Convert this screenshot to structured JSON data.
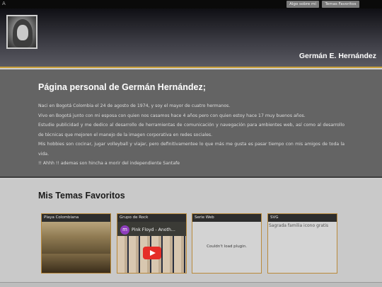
{
  "topbar": {
    "menu_icon": "A",
    "nav": [
      "Algo sobre mí",
      "Temas Favoritos"
    ]
  },
  "header": {
    "name": "Germán E. Hernández"
  },
  "about": {
    "title": "Página personal de Germán Hernández;",
    "paragraphs": [
      "Naci en Bogotá Colombia el 24 de agosto de 1974, y soy el mayor de cuatro hermanos.",
      "Vivo en Bogotá junto con mi esposa con quien nos casamos hace 4 años pero con quien estoy hace 17 muy buenos años.",
      "Estudie publicidad y me dedico al desarrollo de herramientas de comunicación y navegación para ambientes web, así como al desarrollo de técnicas que mejoren el manejo de la imagen corporativa en redes sociales.",
      "Mis hobbies son cocinar, jugar volleyball y viajar, pero definitivamentee lo que más me gusta es pasar tiempo con mis amigos de toda la vida.",
      "!! Ahhh !! ademas son hincha a morir del independiente Santafe"
    ]
  },
  "favorites": {
    "title": "Mis Temas Favoritos",
    "cards": [
      {
        "label": "Playa Colombiana"
      },
      {
        "label": "Grupo de Rock",
        "video_channel_initial": "m",
        "video_title": "Pink Floyd - Anoth..."
      },
      {
        "label": "Serie Web",
        "plugin_message": "Couldn't load plugin."
      },
      {
        "label": "SVG",
        "image_alt": "Sagrada familia icono gratis"
      }
    ]
  },
  "colors": {
    "accent_gold": "#c9a03b",
    "youtube_red": "#e52d27"
  }
}
